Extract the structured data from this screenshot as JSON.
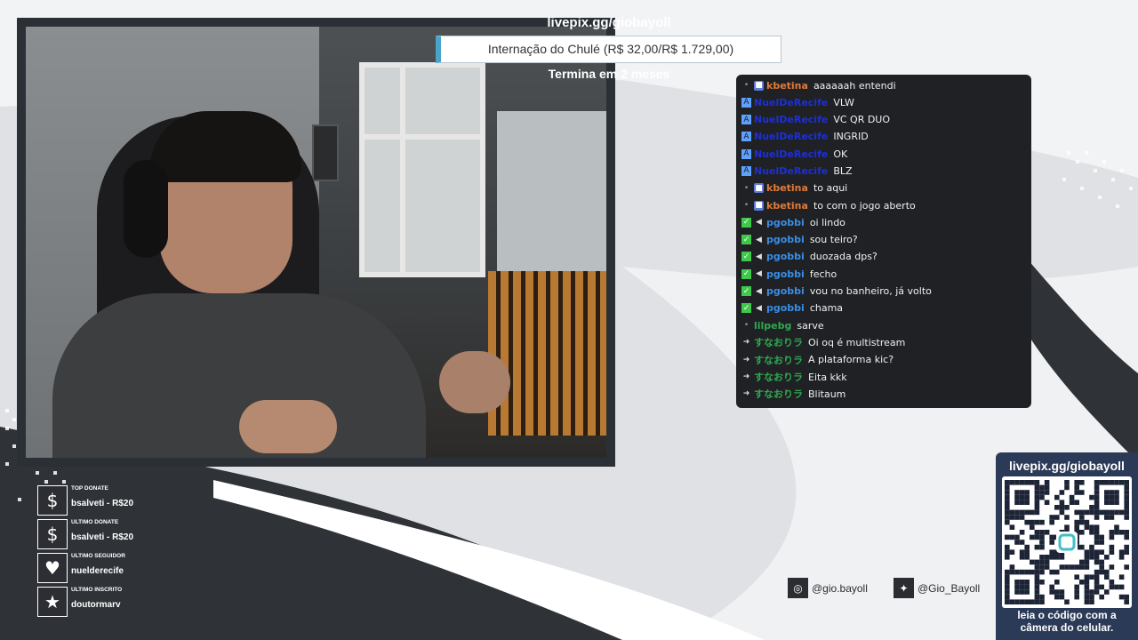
{
  "overlay": {
    "site_url": "livepix.gg/giobayoll",
    "goal_text": "Internação do Chulé (R$ 32,00/R$ 1.729,00)",
    "goal_progress": 0.0185,
    "goal_ends": "Termina em 2 meses"
  },
  "chat": {
    "messages": [
      {
        "user": "kbetina",
        "text": "aaaaaah entendi",
        "color": "#e07a3b",
        "badges": [
          "dot",
          "plat"
        ]
      },
      {
        "user": "NuelDeRecife",
        "text": "VLW",
        "color": "#1d2fd8",
        "badges": [
          "a"
        ]
      },
      {
        "user": "NuelDeRecife",
        "text": "VC QR DUO",
        "color": "#1d2fd8",
        "badges": [
          "a"
        ]
      },
      {
        "user": "NuelDeRecife",
        "text": "INGRID",
        "color": "#1d2fd8",
        "badges": [
          "a"
        ]
      },
      {
        "user": "NuelDeRecife",
        "text": "OK",
        "color": "#1d2fd8",
        "badges": [
          "a"
        ]
      },
      {
        "user": "NuelDeRecife",
        "text": "BLZ",
        "color": "#1d2fd8",
        "badges": [
          "a"
        ]
      },
      {
        "user": "kbetina",
        "text": "to aqui",
        "color": "#e07a3b",
        "badges": [
          "dot",
          "plat"
        ]
      },
      {
        "user": "kbetina",
        "text": "to com o jogo aberto",
        "color": "#e07a3b",
        "badges": [
          "dot",
          "plat"
        ]
      },
      {
        "user": "pgobbi",
        "text": "oi lindo",
        "color": "#3a8ee6",
        "badges": [
          "check",
          "speaker"
        ]
      },
      {
        "user": "pgobbi",
        "text": "sou teiro?",
        "color": "#3a8ee6",
        "badges": [
          "check",
          "speaker"
        ]
      },
      {
        "user": "pgobbi",
        "text": "duozada dps?",
        "color": "#3a8ee6",
        "badges": [
          "check",
          "speaker"
        ]
      },
      {
        "user": "pgobbi",
        "text": "fecho",
        "color": "#3a8ee6",
        "badges": [
          "check",
          "speaker"
        ]
      },
      {
        "user": "pgobbi",
        "text": "vou no banheiro, já volto",
        "color": "#3a8ee6",
        "badges": [
          "check",
          "speaker"
        ]
      },
      {
        "user": "pgobbi",
        "text": "chama",
        "color": "#3a8ee6",
        "badges": [
          "check",
          "speaker"
        ]
      },
      {
        "user": "lilpebg",
        "text": "sarve",
        "color": "#2fa84f",
        "badges": [
          "dot"
        ]
      },
      {
        "user": "すなおりラ",
        "text": "Oi oq é multistream",
        "color": "#2fa84f",
        "badges": [
          "arrow"
        ]
      },
      {
        "user": "すなおりラ",
        "text": "A plataforma kic?",
        "color": "#2fa84f",
        "badges": [
          "arrow"
        ]
      },
      {
        "user": "すなおりラ",
        "text": "Eita kkk",
        "color": "#2fa84f",
        "badges": [
          "arrow"
        ]
      },
      {
        "user": "すなおりラ",
        "text": "Blitaum",
        "color": "#2fa84f",
        "badges": [
          "arrow"
        ]
      }
    ]
  },
  "stats": [
    {
      "label": "TOP DONATE",
      "value": "bsalveti - R$20",
      "icon": "money-bag-icon",
      "glyph": "$"
    },
    {
      "label": "ULTIMO DONATE",
      "value": "bsalveti - R$20",
      "icon": "dollar-icon",
      "glyph": "$"
    },
    {
      "label": "ULTIMO SEGUIDOR",
      "value": "nuelderecife",
      "icon": "heart-icon",
      "glyph": "♥"
    },
    {
      "label": "ULTIMO INSCRITO",
      "value": "doutormarv",
      "icon": "star-icon",
      "glyph": "★"
    }
  ],
  "socials": {
    "instagram": "@gio.bayoll",
    "twitter": "@Gio_Bayoll"
  },
  "qr": {
    "url": "livepix.gg/giobayoll",
    "caption_line1": "leia o código com a",
    "caption_line2": "câmera do celular."
  },
  "colors": {
    "accent": "#4aa3c8",
    "panel_dark": "#2b2f36",
    "qr_panel": "#2b3a57",
    "chat_bg": "#1f2124"
  }
}
